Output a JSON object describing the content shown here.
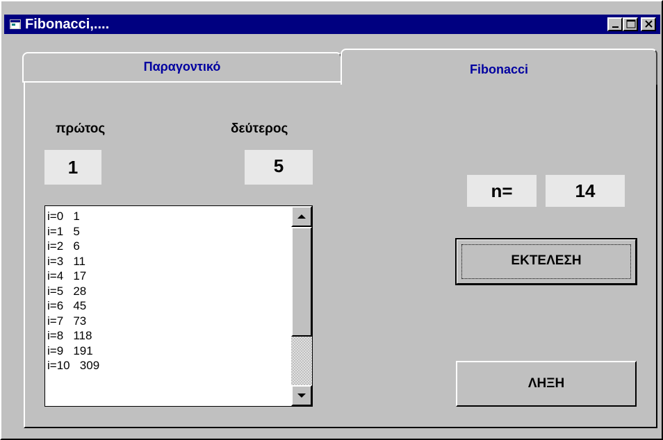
{
  "window": {
    "title": "Fibonacci,....",
    "icon": "app-window-icon",
    "controls": [
      "minimize-icon",
      "maximize-icon",
      "close-icon"
    ]
  },
  "tabs": [
    {
      "label": "Παραγοντικό",
      "active": false
    },
    {
      "label": "Fibonacci",
      "active": true
    }
  ],
  "first": {
    "label": "πρώτος",
    "value": "1"
  },
  "second": {
    "label": "δεύτερος",
    "value": "5"
  },
  "n": {
    "label": "n=",
    "value": "14"
  },
  "list": {
    "items": [
      "i=0   1",
      "i=1   5",
      "i=2   6",
      "i=3   11",
      "i=4   17",
      "i=5   28",
      "i=6   45",
      "i=7   73",
      "i=8   118",
      "i=9   191",
      "i=10   309"
    ]
  },
  "buttons": {
    "run": "ΕΚΤΕΛΕΣΗ",
    "exit": "ΛΗΞΗ"
  },
  "colors": {
    "titlebar": "#000080",
    "face": "#c0c0c0",
    "tab_text": "#0000a0"
  }
}
